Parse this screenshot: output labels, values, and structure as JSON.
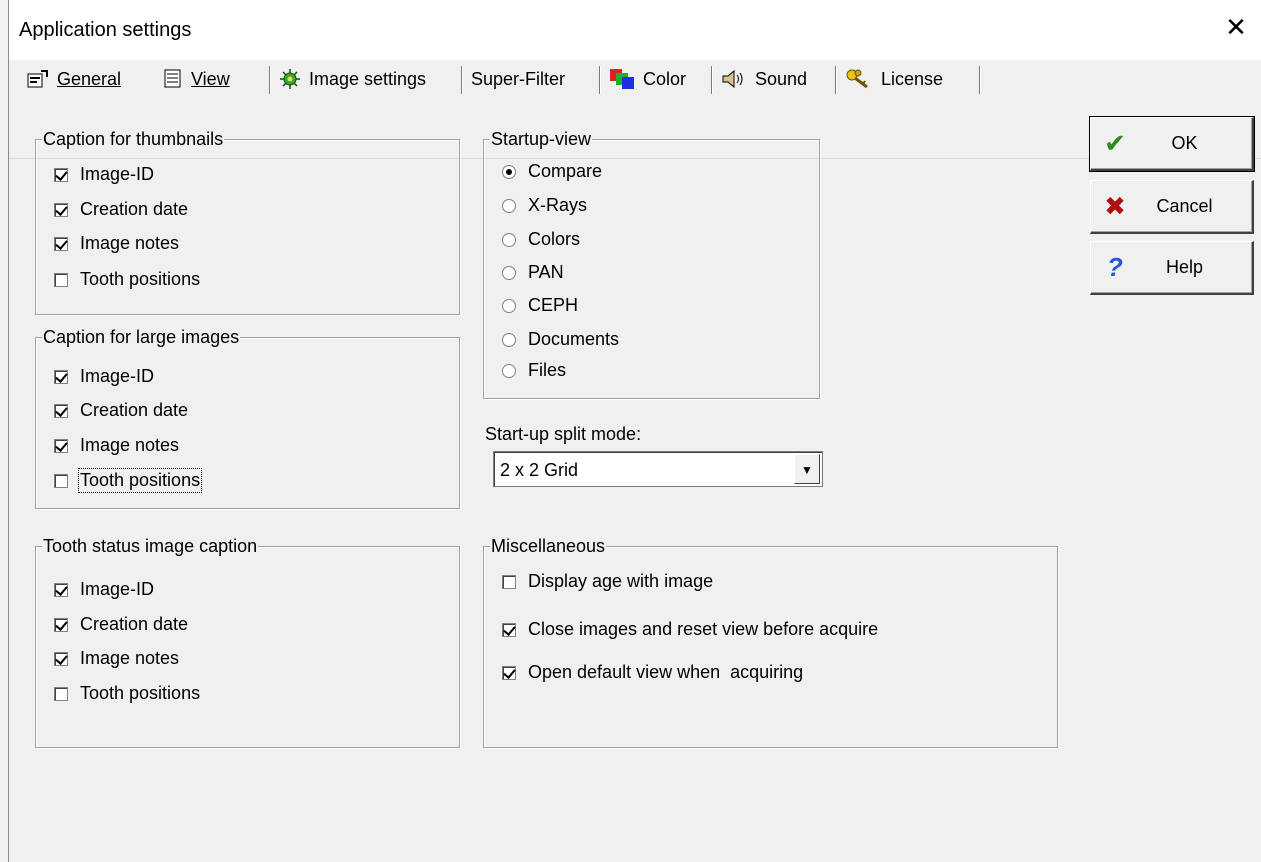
{
  "window": {
    "title": "Application settings"
  },
  "tabs": [
    {
      "label": "General",
      "icon": "properties-icon"
    },
    {
      "label": "View",
      "icon": "document-view-icon"
    },
    {
      "label": "Image settings",
      "icon": "bug-icon"
    },
    {
      "label": "Super-Filter",
      "icon": ""
    },
    {
      "label": "Color",
      "icon": "color-squares-icon"
    },
    {
      "label": "Sound",
      "icon": "speaker-icon"
    },
    {
      "label": "License",
      "icon": "keys-icon"
    }
  ],
  "thumbnails": {
    "title": "Caption for thumbnails",
    "items": [
      {
        "label": "Image-ID",
        "checked": true
      },
      {
        "label": "Creation date",
        "checked": true
      },
      {
        "label": "Image notes",
        "checked": true
      },
      {
        "label": "Tooth positions",
        "checked": false
      }
    ]
  },
  "large_images": {
    "title": "Caption for large images",
    "items": [
      {
        "label": "Image-ID",
        "checked": true
      },
      {
        "label": "Creation date",
        "checked": true
      },
      {
        "label": "Image notes",
        "checked": true
      },
      {
        "label": "Tooth positions",
        "checked": false
      }
    ]
  },
  "tooth_status": {
    "title": "Tooth status image caption",
    "items": [
      {
        "label": "Image-ID",
        "checked": true
      },
      {
        "label": "Creation date",
        "checked": true
      },
      {
        "label": "Image notes",
        "checked": true
      },
      {
        "label": "Tooth positions",
        "checked": false
      }
    ]
  },
  "startup_view": {
    "title": "Startup-view",
    "options": [
      "Compare",
      "X-Rays",
      "Colors",
      "PAN",
      "CEPH",
      "Documents",
      "Files"
    ],
    "selected": "Compare"
  },
  "split_mode": {
    "label": "Start-up split mode:",
    "value": "2 x 2 Grid"
  },
  "misc": {
    "title": "Miscellaneous",
    "items": [
      {
        "label": "Display age with image",
        "checked": false
      },
      {
        "label": "Close images and reset view before acquire",
        "checked": true
      },
      {
        "label": "Open default view when  acquiring",
        "checked": true
      }
    ]
  },
  "buttons": {
    "ok": "OK",
    "cancel": "Cancel",
    "help": "Help"
  },
  "colors": {
    "ok_check": "#2e8b1e",
    "cancel_x": "#b01010",
    "help_q": "#1e5bd0"
  }
}
